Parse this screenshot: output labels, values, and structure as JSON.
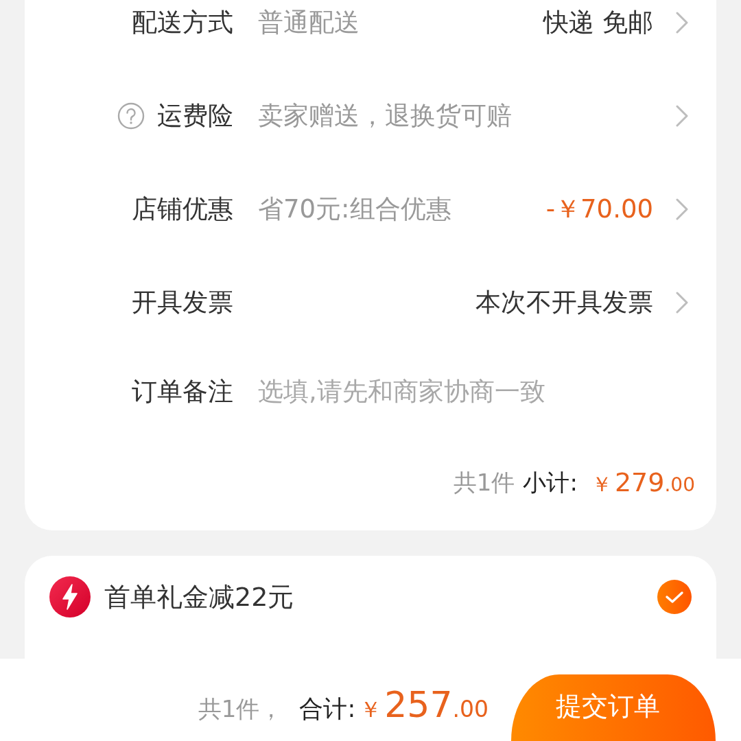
{
  "order_details": {
    "rows": [
      {
        "kind": "option",
        "label": "配送方式",
        "value": "普通配送",
        "detail": "快递 免邮",
        "help": false
      },
      {
        "kind": "option",
        "label": "运费险",
        "value": "卖家赠送，退换货可赔",
        "help": true
      },
      {
        "kind": "discount",
        "label": "店铺优惠",
        "value": "省70元:组合优惠",
        "detail": "-￥70.00",
        "help": false
      },
      {
        "kind": "option",
        "label": "开具发票",
        "detail": "本次不开具发票",
        "help": false
      },
      {
        "kind": "input",
        "label": "订单备注",
        "placeholder": "选填,请先和商家协商一致",
        "help": false
      }
    ],
    "subtotal": {
      "count": "共1件",
      "label": "小计:",
      "amount": {
        "currency": "￥",
        "whole": "279",
        "fraction": ".00"
      }
    }
  },
  "gift": {
    "title": "首单礼金减22元",
    "selected": true
  },
  "checkout_bar": {
    "count": "共1件，",
    "label": "合计:",
    "amount": {
      "currency": "￥",
      "whole": "257",
      "fraction": ".00"
    },
    "submit_button": "提交订单"
  }
}
